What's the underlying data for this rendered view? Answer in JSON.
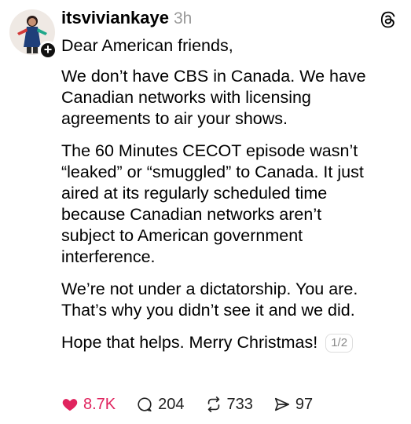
{
  "post": {
    "username": "itsviviankaye",
    "timestamp": "3h",
    "follow_badge": "+",
    "paragraphs": [
      "Dear American friends,",
      "We don’t have CBS in Canada. We have\nCanadian networks with licensing\nagreements to air your shows.",
      "The 60 Minutes CECOT episode wasn’t\n“leaked” or “smuggled” to Canada. It just\naired at its regularly scheduled time\nbecause Canadian networks aren’t\nsubject to American government\ninterference.",
      "We’re not under a dictatorship. You are.\nThat’s why you didn’t see it and we did."
    ],
    "last_line": "Hope that helps. Merry Christmas!",
    "page_indicator": "1/2"
  },
  "actions": {
    "likes": "8.7K",
    "replies": "204",
    "reposts": "733",
    "shares": "97"
  },
  "icons": {
    "like": "heart-filled-icon",
    "reply": "speech-bubble-icon",
    "repost": "repost-arrows-icon",
    "share": "send-icon",
    "logo": "threads-logo-icon"
  },
  "colors": {
    "like_red": "#e0245e",
    "timestamp_gray": "#999999"
  }
}
